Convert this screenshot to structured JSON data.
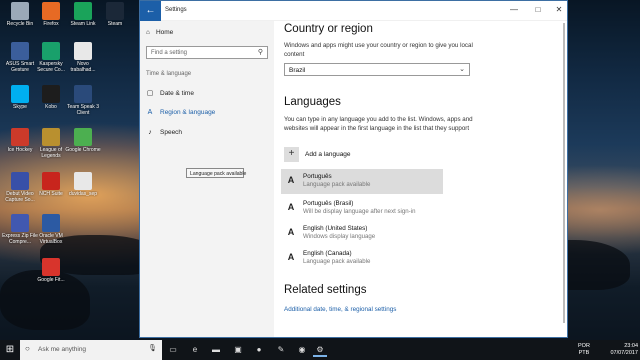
{
  "desktop": {
    "icons": [
      {
        "label": "Recycle Bin",
        "color": "#9aa9b8"
      },
      {
        "label": "Firefox",
        "color": "#e76a24"
      },
      {
        "label": "Steam Link",
        "color": "#1aa35a"
      },
      {
        "label": "Steam",
        "color": "#1b2838"
      },
      {
        "label": "ASUS Smart Gesture",
        "color": "#3b5e9b"
      },
      {
        "label": "Kaspersky Secure Co...",
        "color": "#19a06b"
      },
      {
        "label": "Novo trabalhad...",
        "color": "#e8e8e8"
      },
      {
        "label": "Skype",
        "color": "#00aff0"
      },
      {
        "label": "Kobo",
        "color": "#1d1d1d"
      },
      {
        "label": "Team Speak 3 Client",
        "color": "#2a4a7a"
      },
      {
        "label": "Ice Hockey",
        "color": "#cc3a2a"
      },
      {
        "label": "League of Legends",
        "color": "#b9902f"
      },
      {
        "label": "Google Chrome",
        "color": "#4caf50"
      },
      {
        "label": "Debut Video Capture So...",
        "color": "#3850a8"
      },
      {
        "label": "NCH Suite",
        "color": "#c8251d"
      },
      {
        "label": "duvidas_sep",
        "color": "#e8e8e8"
      },
      {
        "label": "Express Zip File Compre...",
        "color": "#4158b0"
      },
      {
        "label": "Oracle VM VirtualBox",
        "color": "#2c5aa3"
      },
      {
        "label": "Google Fit...",
        "color": "#d8342c"
      }
    ]
  },
  "window": {
    "title": "Settings",
    "back_icon": "←",
    "controls": {
      "minimize": "—",
      "maximize": "□",
      "close": "✕"
    }
  },
  "sidebar": {
    "home": "Home",
    "search_placeholder": "Find a setting",
    "section": "Time & language",
    "items": [
      {
        "label": "Date & time",
        "icon": "▢"
      },
      {
        "label": "Region & language",
        "icon": "A"
      },
      {
        "label": "Speech",
        "icon": "♪"
      }
    ]
  },
  "content": {
    "country_heading": "Country or region",
    "country_desc": "Windows and apps might use your country or region to give you local content",
    "country_value": "Brazil",
    "languages_heading": "Languages",
    "languages_desc": "You can type in any language you add to the list. Windows, apps and websites will appear in the first language in the list that they support",
    "add_language": "Add a language",
    "languages": [
      {
        "name": "Português",
        "status": "Language pack available"
      },
      {
        "name": "Português (Brasil)",
        "status": "Will be display language after next sign-in"
      },
      {
        "name": "English (United States)",
        "status": "Windows display language"
      },
      {
        "name": "English (Canada)",
        "status": "Language pack available"
      }
    ],
    "tooltip": "Language pack available",
    "related_heading": "Related settings",
    "related_link": "Additional date, time, & regional settings"
  },
  "taskbar": {
    "search_placeholder": "Ask me anything",
    "lang_top": "POR",
    "lang_bottom": "PTB",
    "time": "23:04",
    "date": "07/07/2017"
  }
}
